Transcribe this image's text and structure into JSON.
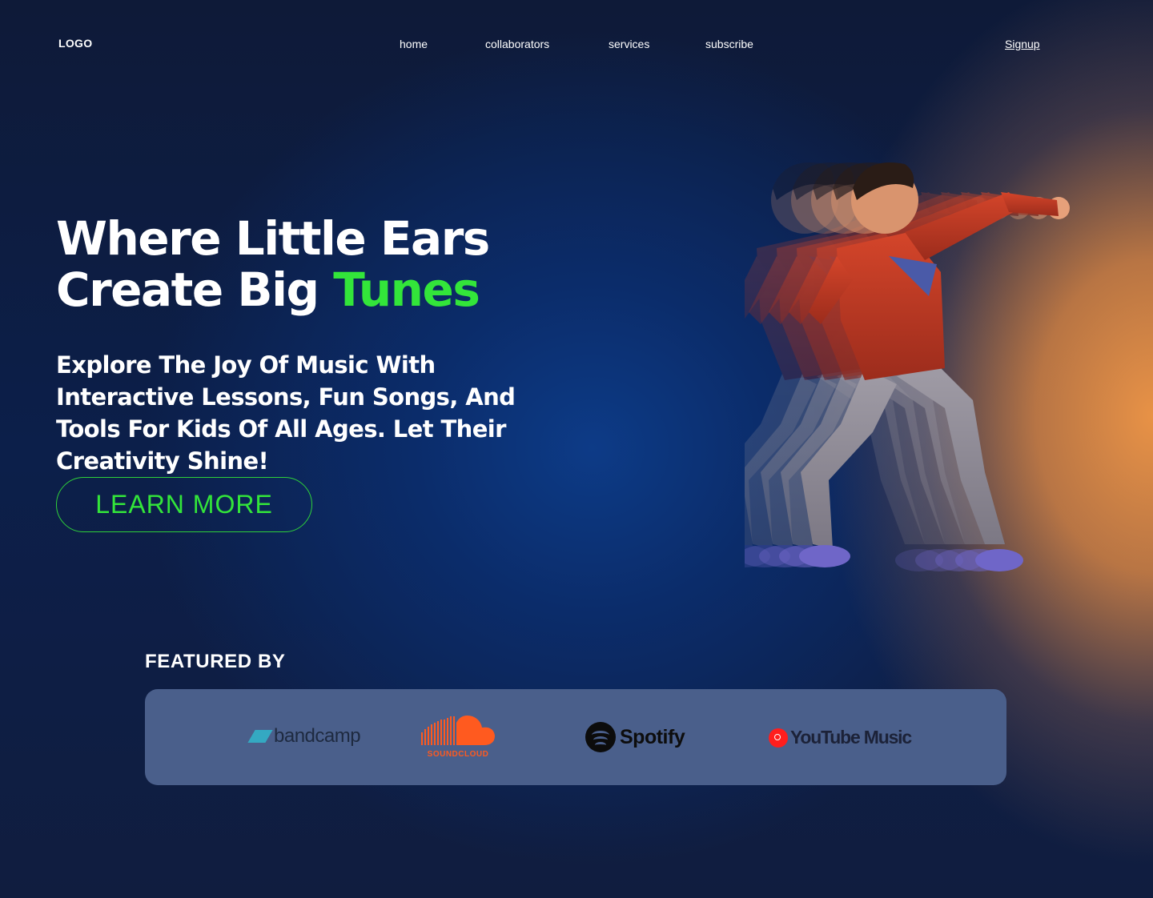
{
  "nav": {
    "logo": "LOGO",
    "links": [
      {
        "label": "home"
      },
      {
        "label": "collaborators"
      },
      {
        "label": "services"
      },
      {
        "label": "subscribe"
      }
    ],
    "signup": "Signup"
  },
  "hero": {
    "title_line1": "Where Little Ears",
    "title_line2": "Create Big ",
    "title_accent": "Tunes",
    "subtitle": "Explore The Joy Of Music With Interactive Lessons, Fun Songs, And Tools For Kids Of All Ages. Let Their Creativity Shine!",
    "cta": "LEARN MORE",
    "accent_color": "#33e53a"
  },
  "featured": {
    "label": "FEATURED BY",
    "brands": [
      {
        "name": "bandcamp",
        "icon": "bandcamp-logo"
      },
      {
        "name": "SOUNDCLOUD",
        "icon": "soundcloud-logo"
      },
      {
        "name": "Spotify",
        "icon": "spotify-logo"
      },
      {
        "name": "YouTube Music",
        "icon": "youtube-music-logo"
      }
    ]
  }
}
